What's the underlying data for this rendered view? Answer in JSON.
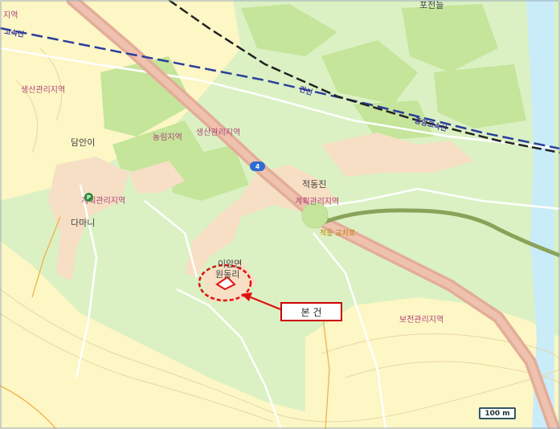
{
  "map": {
    "labels": {
      "corner_zone": "지역",
      "express_rail": "고속선",
      "sangsan_zone": "생산관리지역",
      "damani": "담안이",
      "nongrim": "농림지역",
      "saengsan2": "생산관리지역",
      "gyehoek_west": "계획관리지역",
      "damani2": "다마니",
      "pojeon": "포전늘",
      "line_main": "간선",
      "line_high": "중앙고속선",
      "jeokdong": "적동진",
      "gyehoek_east": "계획관리지역",
      "road_label": "적동 교차로",
      "myeon": "이암면",
      "ri": "원동리",
      "bojeon": "보전관리지역"
    },
    "route_number": "4",
    "callout_text": "본 건",
    "scale_text": "100 m",
    "colors": {
      "yellow_zone": "#fdf6c5",
      "green_zone": "#dbf1c3",
      "bright_green": "#c4e59a",
      "urban": "#f6dfc4",
      "highway": "#e3ad98",
      "river": "#c9ecf8",
      "marker": "#e01010"
    }
  }
}
